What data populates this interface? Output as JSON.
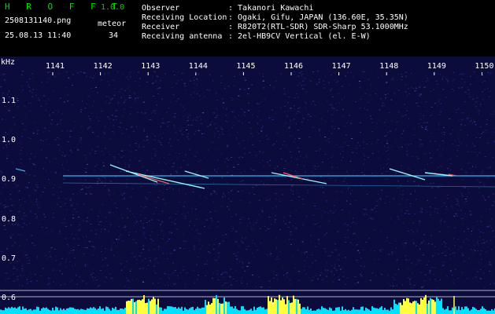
{
  "header": {
    "app_title": "H R O F F T",
    "app_version": "1.0.0",
    "filename": "2508131140.png",
    "datetime": "25.08.13 11:40",
    "meteor_label": "meteor",
    "meteor_count": "34",
    "observer_label": "Observer",
    "observer_value": ": Takanori Kawachi",
    "location_label": "Receiving Location",
    "location_value": ": Ogaki, Gifu, JAPAN (136.60E, 35.35N)",
    "receiver_label": "Receiver",
    "receiver_value": ": R820T2(RTL-SDR) SDR-Sharp 53.1000MHz",
    "antenna_label": "Receiving antenna",
    "antenna_value": ": 2el-HB9CV Vertical (el. E-W)"
  },
  "spectrogram": {
    "y_unit": "kHz",
    "x_ticks": [
      "1141",
      "1142",
      "1143",
      "1144",
      "1145",
      "1146",
      "1147",
      "1148",
      "1149",
      "1150"
    ],
    "y_ticks": [
      "1.1",
      "1.0",
      "0.9",
      "0.8",
      "0.7",
      "0.6"
    ],
    "colors": {
      "background": "#0c0c3c",
      "noise": "#3a3aa0",
      "carrier": "#40c0ff",
      "meteor": "#a0ffff",
      "meteor_hot": "#ff6060",
      "histogram": "#00e0ff",
      "histogram_peak": "#ffff40",
      "gridline": "#ffffff"
    }
  }
}
